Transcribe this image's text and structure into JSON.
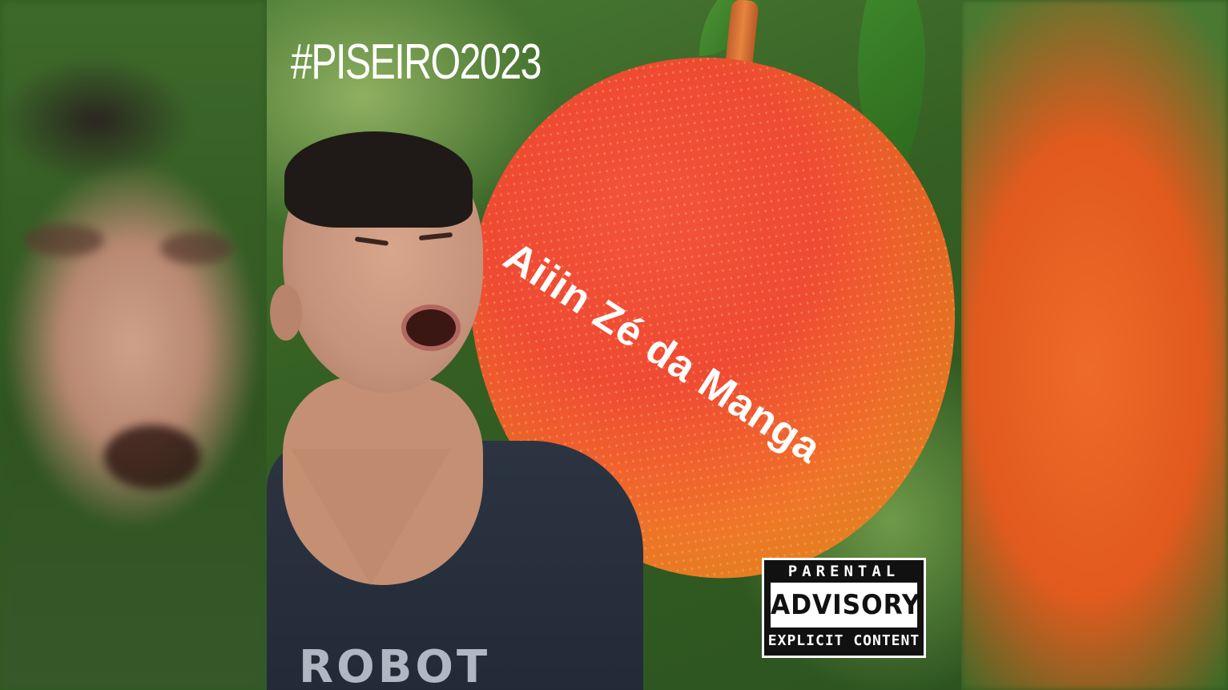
{
  "cover": {
    "hashtag": "#PISEIRO2023",
    "title": "Aiiin Zé da Manga",
    "shirt_text": "ROBOT"
  },
  "advisory": {
    "top": "PARENTAL",
    "middle": "ADVISORY",
    "bottom": "EXPLICIT CONTENT"
  }
}
